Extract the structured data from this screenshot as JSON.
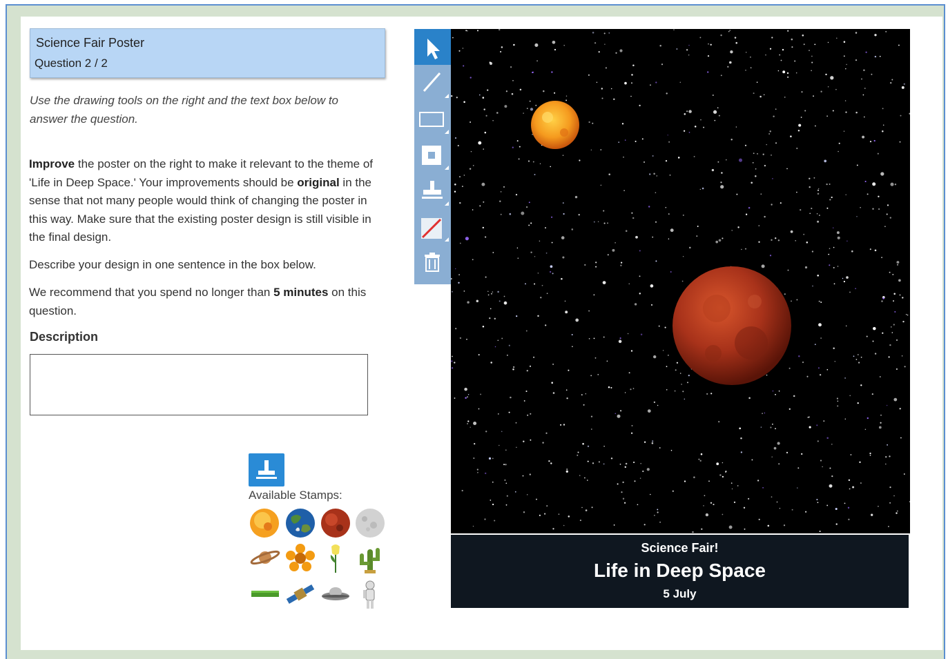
{
  "header": {
    "title": "Science Fair Poster",
    "question": "Question 2 / 2"
  },
  "instructions": "Use the drawing tools on the right and the text box below to answer the question.",
  "prompt": {
    "p1_b1": "Improve",
    "p1_t1": " the poster on the right to make it relevant to the theme of 'Life in Deep Space.' Your improvements should be ",
    "p1_b2": "original",
    "p1_t2": " in the sense that not many people would think of changing the poster in this way. Make sure that the existing poster design is still visible in the final design.",
    "p2": "Describe your design in one sentence in the box below.",
    "p3_t1": "We recommend that you spend no longer than ",
    "p3_b1": "5 minutes",
    "p3_t2": " on this question."
  },
  "description": {
    "label": "Description",
    "value": ""
  },
  "stamps": {
    "label": "Available Stamps:",
    "items": [
      "sun",
      "earth",
      "mars",
      "moon",
      "saturn",
      "flower",
      "tulip",
      "cactus",
      "grass",
      "satellite",
      "flying-saucer",
      "astronaut"
    ]
  },
  "toolbar": {
    "tools": [
      "pointer",
      "line",
      "rectangle",
      "filled-rectangle",
      "stamp",
      "eraser",
      "delete"
    ],
    "active_tool": "pointer"
  },
  "poster": {
    "subtitle": "Science Fair!",
    "title": "Life in Deep Space",
    "date": "5 July"
  },
  "colors": {
    "header_bg": "#b8d6f5",
    "tool_active": "#2a82c9",
    "tool_bg": "#8aaed3",
    "frame_border": "#5b8fd0"
  }
}
